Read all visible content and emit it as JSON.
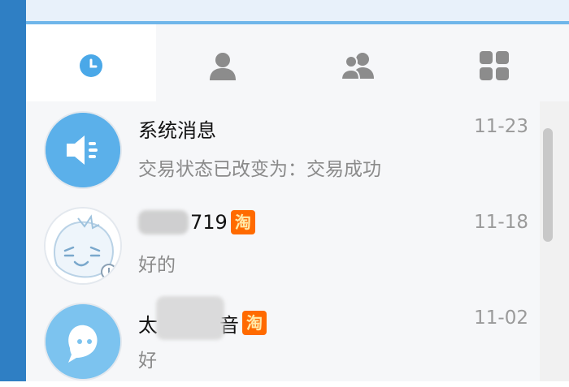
{
  "tabs": [
    {
      "id": "recent",
      "icon": "clock-icon",
      "active": true
    },
    {
      "id": "contacts",
      "icon": "person-icon",
      "active": false
    },
    {
      "id": "groups",
      "icon": "people-icon",
      "active": false
    },
    {
      "id": "apps",
      "icon": "grid-icon",
      "active": false
    }
  ],
  "colors": {
    "accent": "#4aa8e8",
    "icon_gray": "#8c8c8c",
    "badge": "#ff6a00"
  },
  "conversations": [
    {
      "name": "系统消息",
      "preview": "交易状态已改变为：交易成功",
      "time": "11-23",
      "avatar": "speaker-icon"
    },
    {
      "name_suffix": "719",
      "preview": "好的",
      "time": "11-18",
      "badge": "淘",
      "avatar": "cartoon-avatar"
    },
    {
      "name_prefix": "太",
      "name_suffix": "音",
      "preview": "好",
      "time": "11-02",
      "badge": "淘",
      "avatar": "chat-bubble-icon"
    }
  ]
}
